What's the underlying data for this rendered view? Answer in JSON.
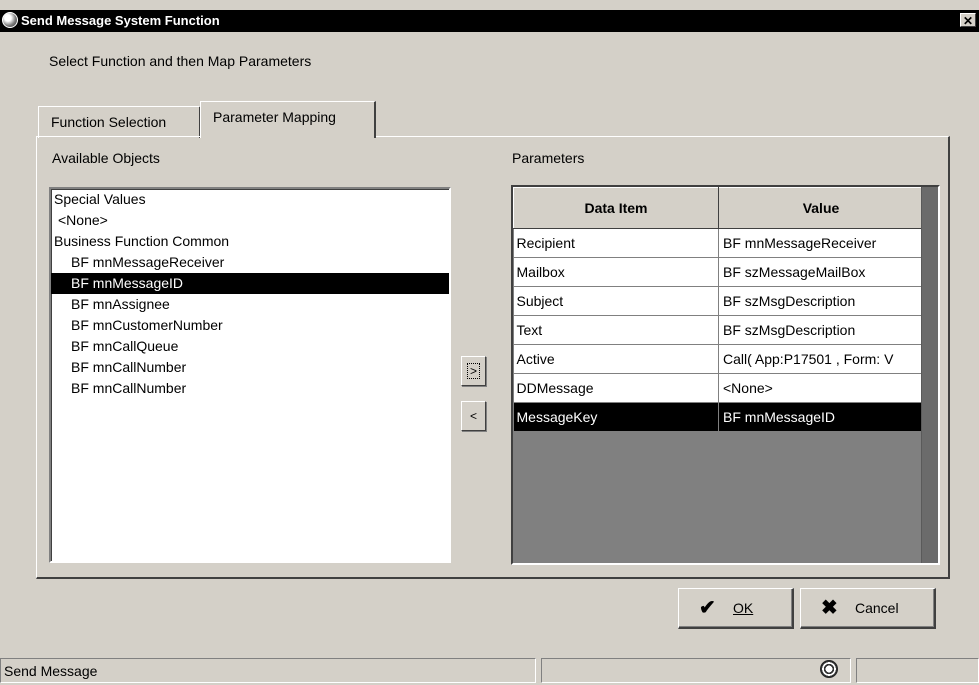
{
  "window": {
    "title": "Send Message System Function",
    "close_label": "✕",
    "instruction": "Select Function and then Map Parameters"
  },
  "tabs": [
    {
      "label": "Function Selection",
      "active": false
    },
    {
      "label": "Parameter Mapping",
      "active": true
    }
  ],
  "available_objects": {
    "label": "Available Objects",
    "items": [
      {
        "text": "Special Values",
        "level": 0,
        "selected": false
      },
      {
        "text": "<None>",
        "level": 1,
        "selected": false
      },
      {
        "text": "Business Function Common",
        "level": 0,
        "selected": false
      },
      {
        "text": "BF  mnMessageReceiver",
        "level": 2,
        "selected": false
      },
      {
        "text": "BF  mnMessageID",
        "level": 2,
        "selected": true
      },
      {
        "text": "BF  mnAssignee",
        "level": 2,
        "selected": false
      },
      {
        "text": "BF  mnCustomerNumber",
        "level": 2,
        "selected": false
      },
      {
        "text": "BF  mnCallQueue",
        "level": 2,
        "selected": false
      },
      {
        "text": "BF  mnCallNumber",
        "level": 2,
        "selected": false
      },
      {
        "text": "BF  mnCallNumber",
        "level": 2,
        "selected": false
      }
    ]
  },
  "move_buttons": {
    "add": ">",
    "remove": "<"
  },
  "parameters": {
    "label": "Parameters",
    "columns": [
      "Data Item",
      "Value"
    ],
    "rows": [
      {
        "item": "Recipient",
        "value": "BF mnMessageReceiver",
        "selected": false
      },
      {
        "item": "Mailbox",
        "value": "BF szMessageMailBox",
        "selected": false
      },
      {
        "item": "Subject",
        "value": "BF szMsgDescription",
        "selected": false
      },
      {
        "item": "Text",
        "value": "BF szMsgDescription",
        "selected": false
      },
      {
        "item": "Active",
        "value": "Call( App:P17501 , Form: V",
        "selected": false
      },
      {
        "item": "DDMessage",
        "value": " <None>",
        "selected": false
      },
      {
        "item": "MessageKey",
        "value": "BF mnMessageID",
        "selected": true
      }
    ]
  },
  "buttons": {
    "ok_label": "OK",
    "cancel_label": "Cancel"
  },
  "status_bar": {
    "text": "Send Message"
  }
}
